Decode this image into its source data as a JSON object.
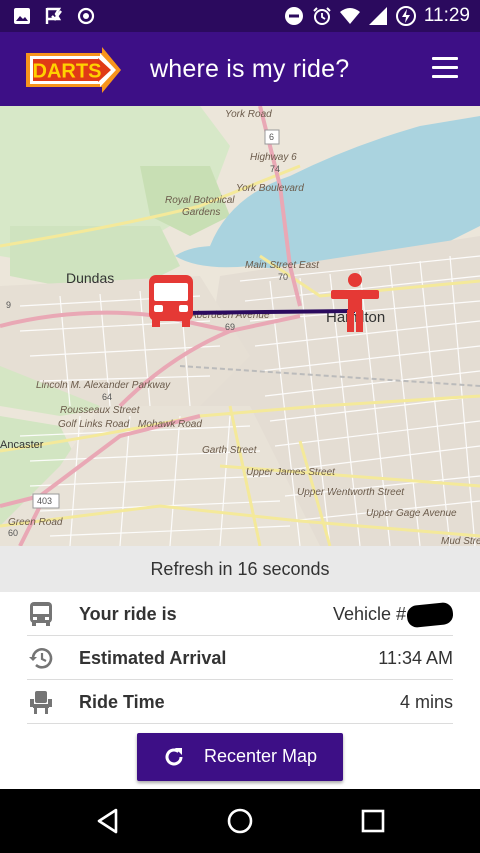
{
  "status_bar": {
    "time": "11:29",
    "left_icons": [
      "image-icon",
      "flag-check-icon",
      "record-icon"
    ],
    "right_icons": [
      "do-not-disturb-icon",
      "alarm-icon",
      "wifi-icon",
      "signal-icon",
      "battery-charging-icon"
    ]
  },
  "app_bar": {
    "logo_text": "DARTS",
    "title": "where is my ride?",
    "menu_icon": "hamburger-menu-icon"
  },
  "map": {
    "labels": {
      "york_road": "York Road",
      "highway_6": "Highway 6",
      "hwy_6_shield": "6",
      "hwy_74": "74",
      "york_boulevard": "York Boulevard",
      "botanical_gardens": "Royal Botonical\nGardens",
      "dundas": "Dundas",
      "main_street_east": "Main Street East",
      "route_70": "70",
      "aberdeen": "Aberdeen Avenue",
      "route_69": "69",
      "hamilton": "Hamilton",
      "lincoln_parkway": "Lincoln M. Alexander Parkway",
      "route_64": "64",
      "rousseaux": "Rousseaux Street",
      "golf_links": "Golf Links Road",
      "mohawk": "Mohawk Road",
      "garth": "Garth Street",
      "upper_james": "Upper James Street",
      "upper_wentworth": "Upper Wentworth Street",
      "upper_gage": "Upper Gage Avenue",
      "ancaster": "Ancaster",
      "route_403": "403",
      "green_road": "Green Road",
      "route_60": "60",
      "mud_street": "Mud Stre",
      "left_edge": "9"
    },
    "markers": {
      "vehicle_icon": "bus-icon",
      "rider_icon": "person-icon",
      "marker_color": "#e53935",
      "route_color": "#2b0a5e"
    }
  },
  "refresh": {
    "text": "Refresh in 16 seconds"
  },
  "info_rows": [
    {
      "icon": "bus-icon",
      "label": "Your ride is",
      "value": "Vehicle #"
    },
    {
      "icon": "history-clock-icon",
      "label": "Estimated Arrival",
      "value": "11:34 AM"
    },
    {
      "icon": "seat-icon",
      "label": "Ride Time",
      "value": "4 mins"
    }
  ],
  "recenter": {
    "label": "Recenter Map",
    "icon": "refresh-icon"
  },
  "colors": {
    "status_bar": "#2b0a5e",
    "app_bar": "#3d0f86",
    "accent": "#3d0f86",
    "logo_orange": "#f7941d",
    "marker_red": "#e53935"
  },
  "nav_bar": {
    "back_icon": "back-triangle-icon",
    "home_icon": "home-circle-icon",
    "recents_icon": "recents-square-icon"
  }
}
